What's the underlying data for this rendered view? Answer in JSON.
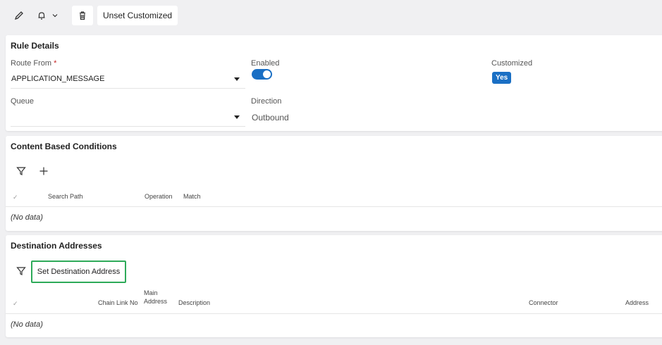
{
  "toolbar": {
    "unset_label": "Unset Customized",
    "icons": [
      "pencil-icon",
      "bell-icon",
      "chevron-down-icon",
      "trash-icon"
    ]
  },
  "rule_details": {
    "title": "Rule Details",
    "route_from": {
      "label": "Route From",
      "required_mark": "*",
      "value": "APPLICATION_MESSAGE"
    },
    "enabled": {
      "label": "Enabled",
      "state": true
    },
    "customized": {
      "label": "Customized",
      "value": "Yes"
    },
    "queue": {
      "label": "Queue",
      "value": ""
    },
    "direction": {
      "label": "Direction",
      "value": "Outbound"
    }
  },
  "content_conditions": {
    "title": "Content Based Conditions",
    "columns": [
      "Search Path",
      "Operation",
      "Match"
    ],
    "empty_text": "(No data)"
  },
  "destination_addresses": {
    "title": "Destination Addresses",
    "set_button_label": "Set Destination Address",
    "columns": {
      "chain_link": "Chain Link No",
      "main_address_1": "Main",
      "main_address_2": "Address",
      "description": "Description",
      "connector": "Connector",
      "address": "Address"
    },
    "empty_text": "(No data)"
  },
  "colors": {
    "accent": "#1a6fc4",
    "highlight_border": "#2eaa59",
    "background": "#f0f0f2"
  }
}
